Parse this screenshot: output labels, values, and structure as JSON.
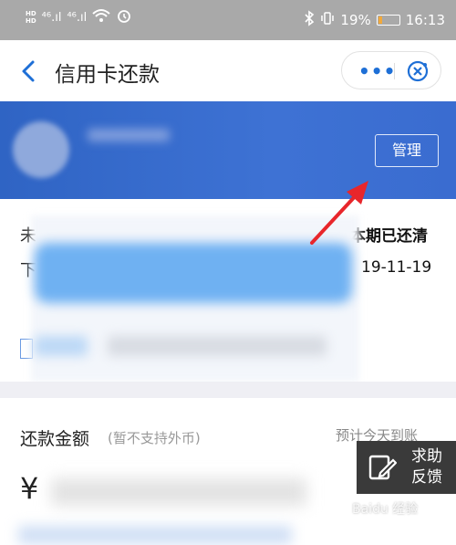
{
  "status_bar": {
    "hd_top": "HD",
    "hd_bottom": "HD",
    "signal_1": "⁴⁶.ıl",
    "signal_2": "⁴⁶.ıl",
    "battery": "19%",
    "battery_level": 0.19,
    "time": "16:13"
  },
  "nav": {
    "title": "信用卡还款",
    "more": "•••"
  },
  "card": {
    "manage_label": "管理"
  },
  "bill": {
    "unpaid_label": "未",
    "status": "本期已还清",
    "next_label": "下",
    "due_date": "19-11-19"
  },
  "repay": {
    "amount_label": "还款金额",
    "amount_note": "(暂不支持外币)",
    "eta": "预计今天到账",
    "currency": "¥"
  },
  "feedback": {
    "line1": "求助",
    "line2": "反馈"
  },
  "watermark": "Baidu 经验",
  "colors": {
    "accent": "#1e6fd6",
    "card_blue": "#3a6cd0",
    "arrow_red": "#e8262b"
  }
}
